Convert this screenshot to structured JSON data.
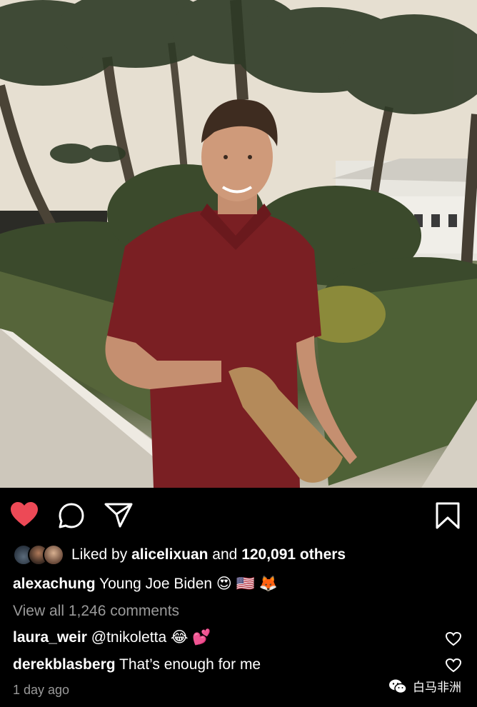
{
  "post": {
    "likes": {
      "prefix": "Liked by",
      "user": "alicelixuan",
      "conjunction": "and",
      "count": "120,091 others"
    },
    "caption": {
      "user": "alexachung",
      "text": "Young Joe Biden",
      "emojis": [
        "😍",
        "🇺🇸",
        "🦊"
      ]
    },
    "view_comments": "View all 1,246 comments",
    "comments": [
      {
        "user": "laura_weir",
        "text": "@tnikoletta",
        "emojis": [
          "😂",
          "💕"
        ]
      },
      {
        "user": "derekblasberg",
        "text": "That’s enough for me"
      }
    ],
    "timestamp": "1 day ago"
  },
  "watermark": {
    "text": "白马非洲"
  },
  "icons": {
    "like": "heart-filled-icon",
    "comment": "comment-icon",
    "share": "send-icon",
    "save": "bookmark-icon",
    "comment_like": "heart-outline-icon"
  },
  "colors": {
    "like": "#ed4956",
    "shirt": "#7a1f23",
    "muted": "#9a9a9a"
  }
}
